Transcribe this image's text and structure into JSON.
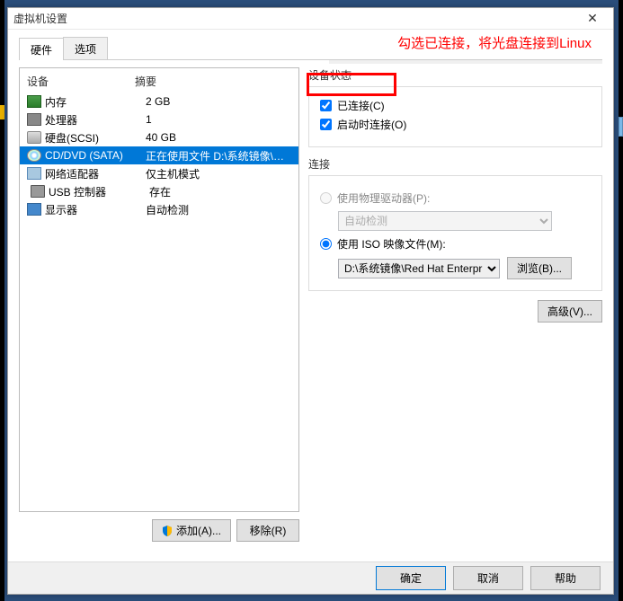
{
  "window": {
    "title": "虚拟机设置",
    "close": "✕"
  },
  "annotation": "勾选已连接，将光盘连接到Linux",
  "tabs": {
    "hardware": "硬件",
    "options": "选项"
  },
  "list": {
    "header_device": "设备",
    "header_summary": "摘要",
    "rows": [
      {
        "icon": "mem",
        "name": "内存",
        "summary": "2 GB"
      },
      {
        "icon": "cpu",
        "name": "处理器",
        "summary": "1"
      },
      {
        "icon": "hdd",
        "name": "硬盘(SCSI)",
        "summary": "40 GB"
      },
      {
        "icon": "cd",
        "name": "CD/DVD (SATA)",
        "summary": "正在使用文件 D:\\系统镜像\\Red H..."
      },
      {
        "icon": "net",
        "name": "网络适配器",
        "summary": "仅主机模式"
      },
      {
        "icon": "usb",
        "name": "USB 控制器",
        "summary": "存在"
      },
      {
        "icon": "display",
        "name": "显示器",
        "summary": "自动检测"
      }
    ],
    "selected_index": 3
  },
  "left_buttons": {
    "add": "添加(A)...",
    "remove": "移除(R)"
  },
  "status": {
    "group": "设备状态",
    "connected": "已连接(C)",
    "connect_at_poweron": "启动时连接(O)"
  },
  "connection": {
    "group": "连接",
    "use_physical": "使用物理驱动器(P):",
    "physical_value": "自动检测",
    "use_iso": "使用 ISO 映像文件(M):",
    "iso_path": "D:\\系统镜像\\Red Hat Enterpris",
    "browse": "浏览(B)..."
  },
  "advanced": "高级(V)...",
  "footer": {
    "ok": "确定",
    "cancel": "取消",
    "help": "帮助"
  }
}
